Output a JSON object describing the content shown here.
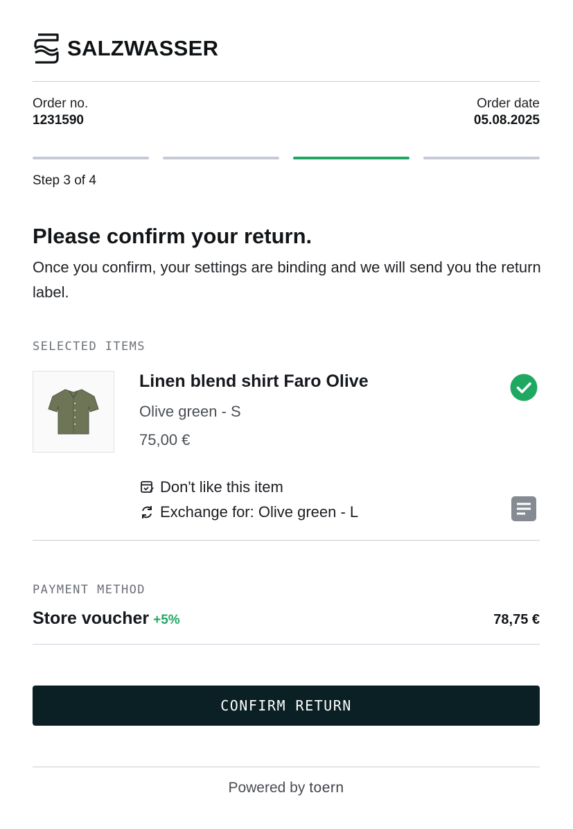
{
  "brand": {
    "name": "SALZWASSER",
    "logo_icon": "wave-logo-icon"
  },
  "order": {
    "number_label": "Order no.",
    "number_value": "1231590",
    "date_label": "Order date",
    "date_value": "05.08.2025"
  },
  "progress": {
    "current_step": 3,
    "total_steps": 4,
    "label": "Step 3 of 4",
    "active_color": "#1fa862",
    "inactive_color": "#c6cad6"
  },
  "intro": {
    "title": "Please confirm your return.",
    "description": "Once you confirm, your settings are binding and we will send you the return label."
  },
  "selected_items": {
    "section_label": "SELECTED ITEMS",
    "item": {
      "name": "Linen blend shirt Faro Olive",
      "variant": "Olive green - S",
      "price": "75,00 €",
      "status_icon": "check-circle-icon",
      "reason_icon": "feedback-icon",
      "reason": "Don't like this item",
      "exchange_icon": "exchange-icon",
      "exchange": "Exchange for: Olive green - L",
      "note_icon": "note-icon"
    }
  },
  "payment": {
    "section_label": "PAYMENT METHOD",
    "method": "Store voucher",
    "bonus": "+5%",
    "amount": "78,75 €",
    "bonus_color": "#1fa862"
  },
  "actions": {
    "confirm_label": "CONFIRM RETURN",
    "button_color": "#0a2024"
  },
  "footer": {
    "powered_by": "Powered by",
    "provider": "toern"
  }
}
